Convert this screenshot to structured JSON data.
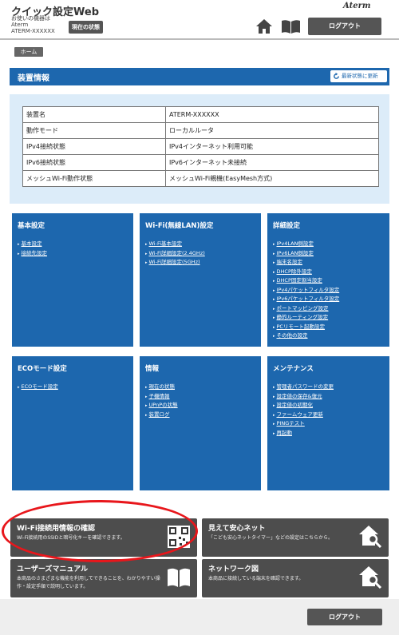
{
  "header": {
    "app_title": "クイック設定Web",
    "device_label": "お使いの機器は",
    "device_name": "Aterm",
    "device_id": "ATERM-XXXXXX",
    "status_button": "現在の状態",
    "brand": "Aterm",
    "logout": "ログアウト"
  },
  "breadcrumb": "ホーム",
  "device_panel": {
    "title": "装置情報",
    "refresh": "最新状態に更新",
    "rows": [
      {
        "key": "装置名",
        "value": "ATERM-XXXXXX"
      },
      {
        "key": "動作モード",
        "value": "ローカルルータ"
      },
      {
        "key": "IPv4接続状態",
        "value": "IPv4インターネット利用可能"
      },
      {
        "key": "IPv6接続状態",
        "value": "IPv6インターネット未接続"
      },
      {
        "key": "メッシュWi-Fi動作状態",
        "value": "メッシュWi-Fi親機(EasyMesh方式)"
      }
    ]
  },
  "tiles": [
    {
      "title": "基本設定",
      "links": [
        "基本設定",
        "接続先設定"
      ]
    },
    {
      "title": "Wi-Fi(無線LAN)設定",
      "links": [
        "Wi-Fi基本設定",
        "Wi-Fi詳細設定(2.4GHz)",
        "Wi-Fi詳細設定(5GHz)"
      ]
    },
    {
      "title": "詳細設定",
      "links": [
        "IPv4LAN側設定",
        "IPv6LAN側設定",
        "端末名設定",
        "DHCP除外設定",
        "DHCP固定割当設定",
        "IPv4パケットフィルタ設定",
        "IPv6パケットフィルタ設定",
        "ポートマッピング設定",
        "静的ルーティング設定",
        "PCリモート起動設定",
        "その他の設定"
      ]
    },
    {
      "title": "ECOモード設定",
      "links": [
        "ECOモード設定"
      ]
    },
    {
      "title": "情報",
      "links": [
        "現在の状態",
        "子機情報",
        "UPnPの状態",
        "装置ログ"
      ]
    },
    {
      "title": "メンテナンス",
      "links": [
        "管理者パスワードの変更",
        "設定値の保存&復元",
        "設定値の初期化",
        "ファームウェア更新",
        "PINGテスト",
        "再起動"
      ]
    }
  ],
  "cards": [
    {
      "title": "Wi-Fi接続用情報の確認",
      "desc": "Wi-Fi接続用のSSIDと暗号化キーを確認できます。",
      "icon": "qr-code-icon"
    },
    {
      "title": "見えて安心ネット",
      "desc": "「こども安心ネットタイマー」などの設定はこちらから。",
      "icon": "home-search-icon"
    },
    {
      "title": "ユーザーズマニュアル",
      "desc": "本商品のさまざまな機能を利用してできることを、わかりやすい操作・設定手順で説明しています。",
      "icon": "book-icon"
    },
    {
      "title": "ネットワーク図",
      "desc": "本商品に接続している端末を確認できます。",
      "icon": "home-search-icon"
    }
  ],
  "footer": {
    "logout": "ログアウト"
  },
  "colors": {
    "panel_blue": "#1d67ae",
    "info_bg": "#dcecf9",
    "card_gray": "#4d4d4d",
    "highlight_red": "#e8161b"
  }
}
